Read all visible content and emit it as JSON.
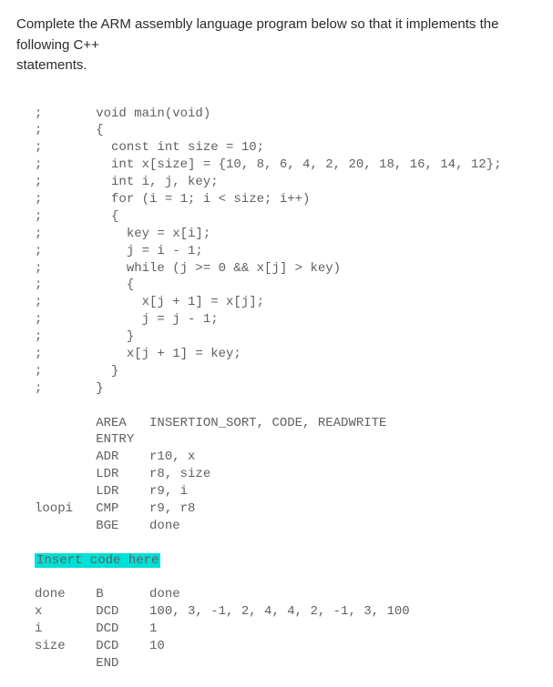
{
  "question": {
    "prompt_line1": "Complete the ARM assembly language program below so that it implements the following C++",
    "prompt_line2": "statements."
  },
  "code": {
    "c0": ";       void main(void)",
    "c1": ";       {",
    "c2": ";         const int size = 10;",
    "c3": ";         int x[size] = {10, 8, 6, 4, 2, 20, 18, 16, 14, 12};",
    "c4": ";         int i, j, key;",
    "c5": ";         for (i = 1; i < size; i++)",
    "c6": ";         {",
    "c7": ";           key = x[i];",
    "c8": ";           j = i - 1;",
    "c9": ";           while (j >= 0 && x[j] > key)",
    "c10": ";           {",
    "c11": ";             x[j + 1] = x[j];",
    "c12": ";             j = j - 1;",
    "c13": ";           }",
    "c14": ";           x[j + 1] = key;",
    "c15": ";         }",
    "c16": ";       }",
    "a0": "        AREA   INSERTION_SORT, CODE, READWRITE",
    "a1": "        ENTRY",
    "a2": "        ADR    r10, x",
    "a3": "        LDR    r8, size",
    "a4": "        LDR    r9, i",
    "a5": "loopi   CMP    r9, r8",
    "a6": "        BGE    done",
    "insert": "Insert code here",
    "a7": "done    B      done",
    "a8": "x       DCD    100, 3, -1, 2, 4, 4, 2, -1, 3, 100",
    "a9": "i       DCD    1",
    "a10": "size    DCD    10",
    "a11": "        END"
  }
}
